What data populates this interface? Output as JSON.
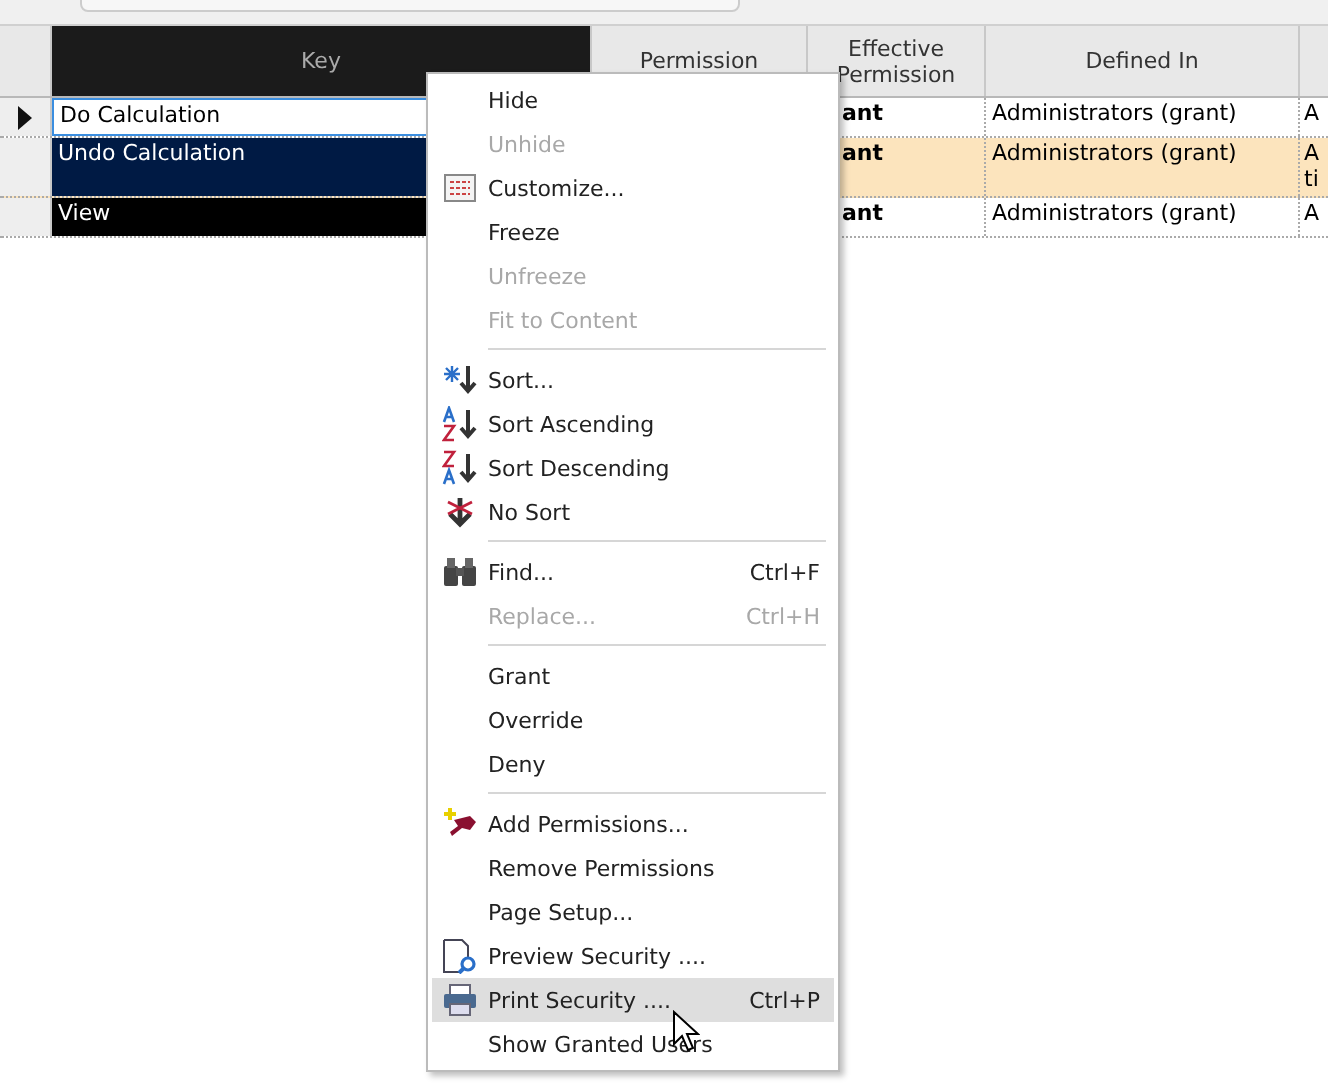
{
  "grid": {
    "columns": [
      "Key",
      "Permission",
      "Effective\nPermission",
      "Defined In"
    ],
    "rows": [
      {
        "key": "Do Calculation",
        "effective": "ant",
        "defined_in": "Administrators (grant)",
        "column_5": "A",
        "current": true,
        "highlighted": false,
        "editing": true
      },
      {
        "key": "Undo Calculation",
        "effective": "ant",
        "defined_in": "Administrators (grant)",
        "column_5": "A ti",
        "current": false,
        "highlighted": true,
        "editing": false
      },
      {
        "key": "View",
        "effective": "ant",
        "defined_in": "Administrators (grant)",
        "column_5": "A",
        "current": false,
        "highlighted": false,
        "editing": false
      }
    ]
  },
  "context_menu": {
    "items": [
      {
        "kind": "item",
        "label": "Hide",
        "disabled": false,
        "selected": false
      },
      {
        "kind": "item",
        "label": "Unhide",
        "disabled": true,
        "selected": false
      },
      {
        "kind": "item",
        "label": "Customize...",
        "disabled": false,
        "selected": false
      },
      {
        "kind": "item",
        "label": "Freeze",
        "disabled": false,
        "selected": false
      },
      {
        "kind": "item",
        "label": "Unfreeze",
        "disabled": true,
        "selected": false
      },
      {
        "kind": "item",
        "label": "Fit to Content",
        "disabled": true,
        "selected": false
      },
      {
        "kind": "separator"
      },
      {
        "kind": "item",
        "label": "Sort...",
        "disabled": false,
        "selected": false
      },
      {
        "kind": "item",
        "label": "Sort Ascending",
        "disabled": false,
        "selected": false
      },
      {
        "kind": "item",
        "label": "Sort Descending",
        "disabled": false,
        "selected": false
      },
      {
        "kind": "item",
        "label": "No Sort",
        "disabled": false,
        "selected": false
      },
      {
        "kind": "separator"
      },
      {
        "kind": "item",
        "label": "Find...",
        "shortcut": "Ctrl+F",
        "disabled": false,
        "selected": false
      },
      {
        "kind": "item",
        "label": "Replace...",
        "shortcut": "Ctrl+H",
        "disabled": true,
        "selected": false
      },
      {
        "kind": "separator"
      },
      {
        "kind": "item",
        "label": "Grant",
        "disabled": false,
        "selected": false
      },
      {
        "kind": "item",
        "label": "Override",
        "disabled": false,
        "selected": false
      },
      {
        "kind": "item",
        "label": "Deny",
        "disabled": false,
        "selected": false
      },
      {
        "kind": "separator"
      },
      {
        "kind": "item",
        "label": "Add Permissions...",
        "disabled": false,
        "selected": false
      },
      {
        "kind": "item",
        "label": "Remove Permissions",
        "disabled": false,
        "selected": false
      },
      {
        "kind": "item",
        "label": "Page Setup...",
        "disabled": false,
        "selected": false
      },
      {
        "kind": "item",
        "label": "Preview Security ....",
        "disabled": false,
        "selected": false
      },
      {
        "kind": "item",
        "label": "Print Security ....",
        "shortcut": "Ctrl+P",
        "disabled": false,
        "selected": true
      },
      {
        "kind": "item",
        "label": "Show Granted Users",
        "disabled": false,
        "selected": false
      }
    ]
  }
}
